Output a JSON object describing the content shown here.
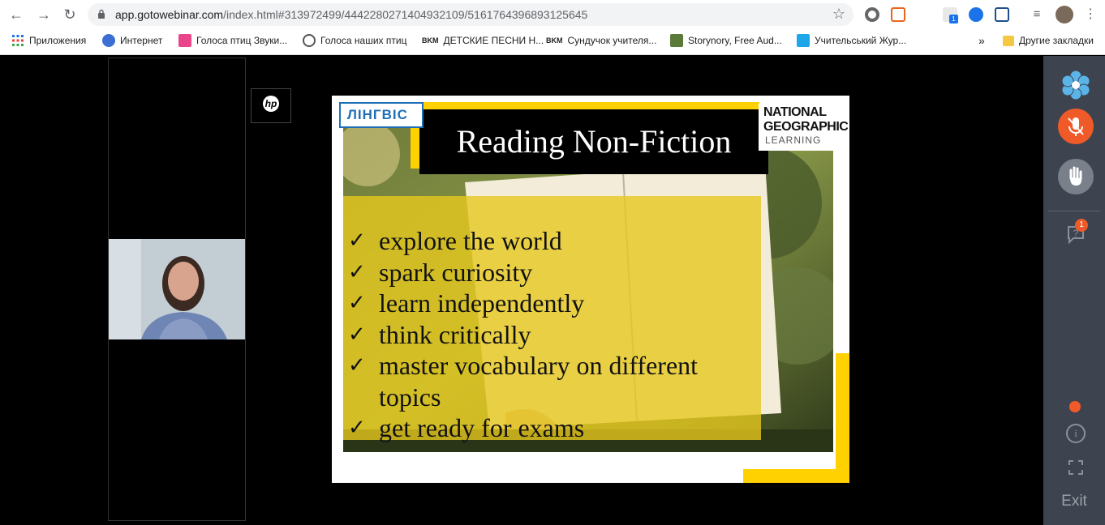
{
  "browser": {
    "url_host": "app.gotowebinar.com",
    "url_path": "/index.html#313972499/4442280271404932109/5161764396893125645",
    "bookmarks": [
      {
        "label": "Приложения",
        "icon": "apps-grid-icon"
      },
      {
        "label": "Интернет",
        "icon": "globe-icon"
      },
      {
        "label": "Голоса птиц Звуки...",
        "icon": "papa-icon"
      },
      {
        "label": "Голоса наших птиц",
        "icon": "globe-icon"
      },
      {
        "label": "ДЕТСКИЕ ПЕСНИ Н...",
        "icon": "vkm-icon"
      },
      {
        "label": "Сундучок учителя...",
        "icon": "vkm-icon"
      },
      {
        "label": "Storynory, Free Aud...",
        "icon": "storynory-icon"
      },
      {
        "label": "Учительський Жур...",
        "icon": "journal-icon"
      }
    ],
    "overflow_label": "»",
    "other_bookmarks": "Другие закладки",
    "extension_badge": "1"
  },
  "slide": {
    "logo_left": "ЛІНГВІС",
    "logo_right_line1": "NATIONAL",
    "logo_right_line2": "GEOGRAPHIC",
    "logo_right_line3": "LEARNING",
    "title": "Reading Non-Fiction",
    "bullets": [
      "explore the world",
      "spark curiosity",
      "learn independently",
      "think critically",
      "master vocabulary on different topics",
      "get ready for exams"
    ]
  },
  "panel": {
    "questions_badge": "1",
    "exit_label": "Exit",
    "colors": {
      "mic": "#f05a28",
      "recording": "#f05a28",
      "background": "#3d4450"
    }
  }
}
